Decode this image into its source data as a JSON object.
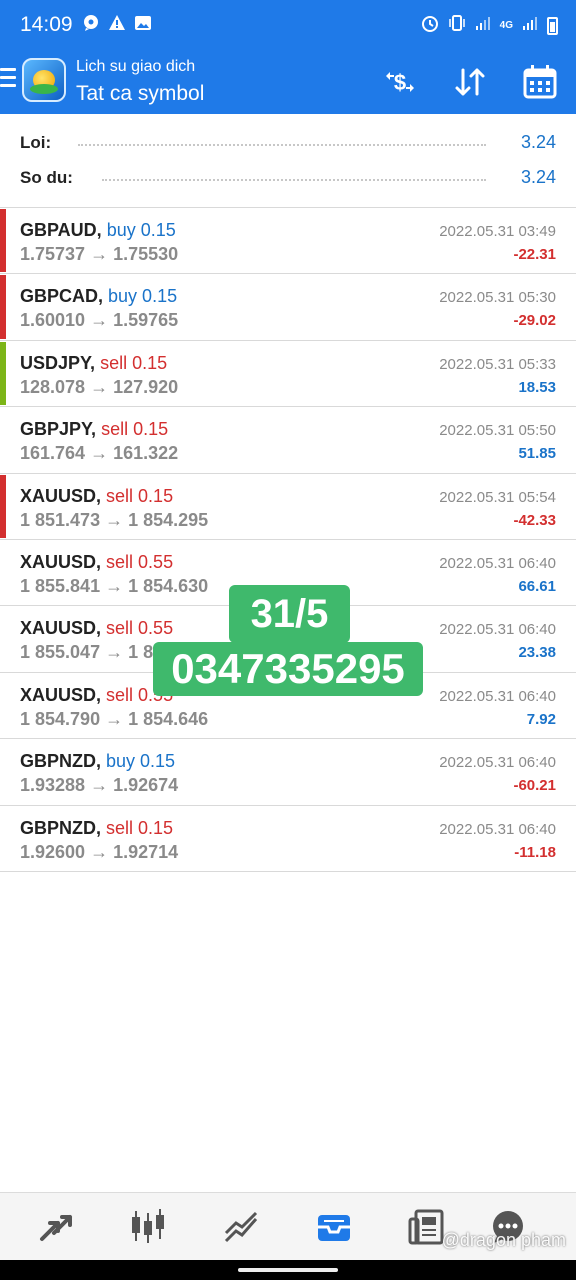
{
  "status_bar": {
    "time": "14:09",
    "network": "4G",
    "left_icons": [
      "chat-bubble-icon",
      "warning-icon",
      "image-icon"
    ],
    "right_icons": [
      "alarm-icon",
      "vibrate-icon",
      "signal-icon",
      "signal-icon",
      "battery-icon"
    ]
  },
  "app_bar": {
    "subtitle": "Lich su giao dich",
    "title": "Tat ca symbol",
    "icons": [
      "menu-icon",
      "app-logo",
      "deposit-dollar-icon",
      "sort-icon",
      "calendar-icon"
    ]
  },
  "summary": {
    "profit_label": "Loi:",
    "profit_value": "3.24",
    "balance_label": "So du:",
    "balance_value": "3.24"
  },
  "deals": [
    {
      "symbol": "GBPAUD,",
      "side": "buy 0.15",
      "side_type": "buy",
      "prices": "1.75737 → 1.75530",
      "date": "2022.05.31 03:49",
      "profit": "-22.31",
      "profit_type": "neg",
      "stripe": "#d32f2f"
    },
    {
      "symbol": "GBPCAD,",
      "side": "buy 0.15",
      "side_type": "buy",
      "prices": "1.60010 → 1.59765",
      "date": "2022.05.31 05:30",
      "profit": "-29.02",
      "profit_type": "neg",
      "stripe": "#d32f2f"
    },
    {
      "symbol": "USDJPY,",
      "side": "sell 0.15",
      "side_type": "sell",
      "prices": "128.078 → 127.920",
      "date": "2022.05.31 05:33",
      "profit": "18.53",
      "profit_type": "pos",
      "stripe": "#7cb518"
    },
    {
      "symbol": "GBPJPY,",
      "side": "sell 0.15",
      "side_type": "sell",
      "prices": "161.764 → 161.322",
      "date": "2022.05.31 05:50",
      "profit": "51.85",
      "profit_type": "pos",
      "stripe": ""
    },
    {
      "symbol": "XAUUSD,",
      "side": "sell 0.15",
      "side_type": "sell",
      "prices": "1 851.473 → 1 854.295",
      "date": "2022.05.31 05:54",
      "profit": "-42.33",
      "profit_type": "neg",
      "stripe": "#d32f2f"
    },
    {
      "symbol": "XAUUSD,",
      "side": "sell 0.55",
      "side_type": "sell",
      "prices": "1 855.841 → 1 854.630",
      "date": "2022.05.31 06:40",
      "profit": "66.61",
      "profit_type": "pos",
      "stripe": ""
    },
    {
      "symbol": "XAUUSD,",
      "side": "sell 0.55",
      "side_type": "sell",
      "prices": "1 855.047 → 1 8",
      "date": "2022.05.31 06:40",
      "profit": "23.38",
      "profit_type": "pos",
      "stripe": ""
    },
    {
      "symbol": "XAUUSD,",
      "side": "sell 0.55",
      "side_type": "sell",
      "prices": "1 854.790 → 1 854.646",
      "date": "2022.05.31 06:40",
      "profit": "7.92",
      "profit_type": "pos",
      "stripe": ""
    },
    {
      "symbol": "GBPNZD,",
      "side": "buy 0.15",
      "side_type": "buy",
      "prices": "1.93288 → 1.92674",
      "date": "2022.05.31 06:40",
      "profit": "-60.21",
      "profit_type": "neg",
      "stripe": ""
    },
    {
      "symbol": "GBPNZD,",
      "side": "sell 0.15",
      "side_type": "sell",
      "prices": "1.92600 → 1.92714",
      "date": "2022.05.31 06:40",
      "profit": "-11.18",
      "profit_type": "neg",
      "stripe": ""
    }
  ],
  "overlay": {
    "line1": "31/5",
    "line2": "0347335295"
  },
  "bottom_nav": {
    "items": [
      "quotes-icon",
      "chart-icon",
      "trade-icon",
      "history-icon",
      "news-icon",
      "messages-icon"
    ],
    "active": "history-icon",
    "active_color": "#1f7ae8"
  },
  "credit": "@dragon pham"
}
